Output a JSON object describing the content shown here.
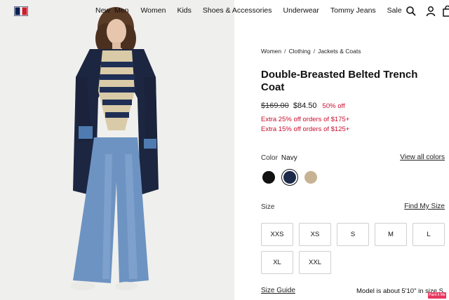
{
  "header": {
    "logo_name": "tommy-hilfiger-flag",
    "nav": [
      "New",
      "Men",
      "Women",
      "Kids",
      "Shoes & Accessories",
      "Underwear",
      "Tommy Jeans",
      "Sale"
    ],
    "icons": [
      "search-icon",
      "account-icon",
      "bag-icon"
    ]
  },
  "breadcrumb": [
    "Women",
    "Clothing",
    "Jackets & Coats"
  ],
  "product": {
    "title": "Double-Breasted Belted Trench Coat",
    "price_original": "$169.00",
    "price_sale": "$84.50",
    "discount": "50% off",
    "promo_1": "Extra 25% off orders of $175+",
    "promo_2": "Extra 15% off orders of $125+"
  },
  "color": {
    "label": "Color",
    "selected": "Navy",
    "view_all": "View all colors",
    "swatches": [
      {
        "name": "Black",
        "hex": "#111111"
      },
      {
        "name": "Navy",
        "hex": "#1b2a4a"
      },
      {
        "name": "Khaki",
        "hex": "#c8b294"
      }
    ]
  },
  "size": {
    "label": "Size",
    "find": "Find My Size",
    "options": [
      "XXS",
      "XS",
      "S",
      "M",
      "L",
      "XL",
      "XXL"
    ],
    "guide": "Size Guide",
    "model_note": "Model is about 5'10\" in size S"
  },
  "overlay_badge": "Paint it Me",
  "colors": {
    "sale_red": "#c8102e",
    "flag_navy": "#0c1f4f",
    "flag_red": "#cc1e2e"
  }
}
